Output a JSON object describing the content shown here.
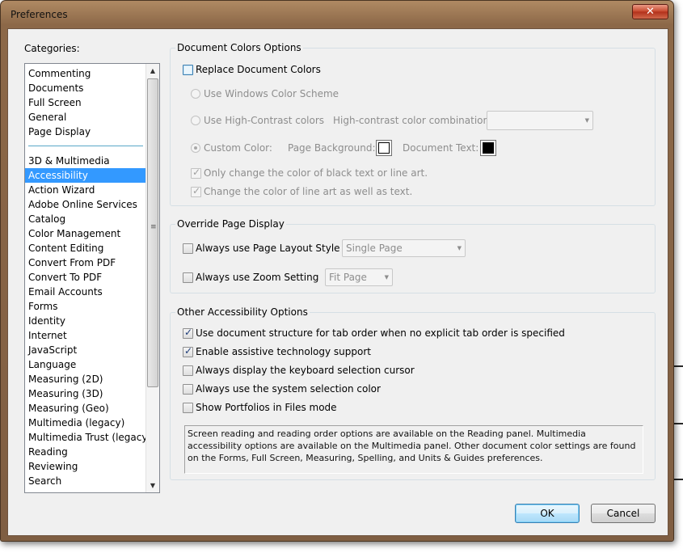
{
  "window": {
    "title": "Preferences",
    "close_glyph": "✕"
  },
  "categories": {
    "label": "Categories:",
    "group1": [
      "Commenting",
      "Documents",
      "Full Screen",
      "General",
      "Page Display"
    ],
    "group2": [
      "3D & Multimedia",
      "Accessibility",
      "Action Wizard",
      "Adobe Online Services",
      "Catalog",
      "Color Management",
      "Content Editing",
      "Convert From PDF",
      "Convert To PDF",
      "Email Accounts",
      "Forms",
      "Identity",
      "Internet",
      "JavaScript",
      "Language",
      "Measuring (2D)",
      "Measuring (3D)",
      "Measuring (Geo)",
      "Multimedia (legacy)",
      "Multimedia Trust (legacy)",
      "Reading",
      "Reviewing",
      "Search"
    ],
    "selected": "Accessibility"
  },
  "doc_colors": {
    "title": "Document Colors Options",
    "replace_label": "Replace Document Colors",
    "replace_checked": false,
    "windows_scheme_label": "Use Windows Color Scheme",
    "high_contrast_label": "Use High-Contrast colors",
    "hc_combo_label": "High-contrast color combination:",
    "hc_combo_value": "",
    "custom_color_label": "Custom Color:",
    "page_bg_label": "Page Background:",
    "page_bg_color": "#ffffff",
    "doc_text_label": "Document Text:",
    "doc_text_color": "#000000",
    "only_black_label": "Only change the color of black text or line art.",
    "only_black_checked": true,
    "line_art_label": "Change the color of line art as well as text.",
    "line_art_checked": true
  },
  "override": {
    "title": "Override Page Display",
    "layout_label": "Always use Page Layout Style",
    "layout_checked": false,
    "layout_value": "Single Page",
    "zoom_label": "Always use Zoom Setting",
    "zoom_checked": false,
    "zoom_value": "Fit Page"
  },
  "other": {
    "title": "Other Accessibility Options",
    "options": [
      {
        "label": "Use document structure for tab order when no explicit tab order is specified",
        "checked": true
      },
      {
        "label": "Enable assistive technology support",
        "checked": true
      },
      {
        "label": "Always display the keyboard selection cursor",
        "checked": false
      },
      {
        "label": "Always use the system selection color",
        "checked": false
      },
      {
        "label": "Show Portfolios in Files mode",
        "checked": false
      }
    ],
    "info_text": "Screen reading and reading order options are available on the Reading panel. Multimedia accessibility options are available on the Multimedia panel. Other document color settings are found on the Forms, Full Screen, Measuring, Spelling, and Units & Guides preferences."
  },
  "buttons": {
    "ok": "OK",
    "cancel": "Cancel"
  }
}
